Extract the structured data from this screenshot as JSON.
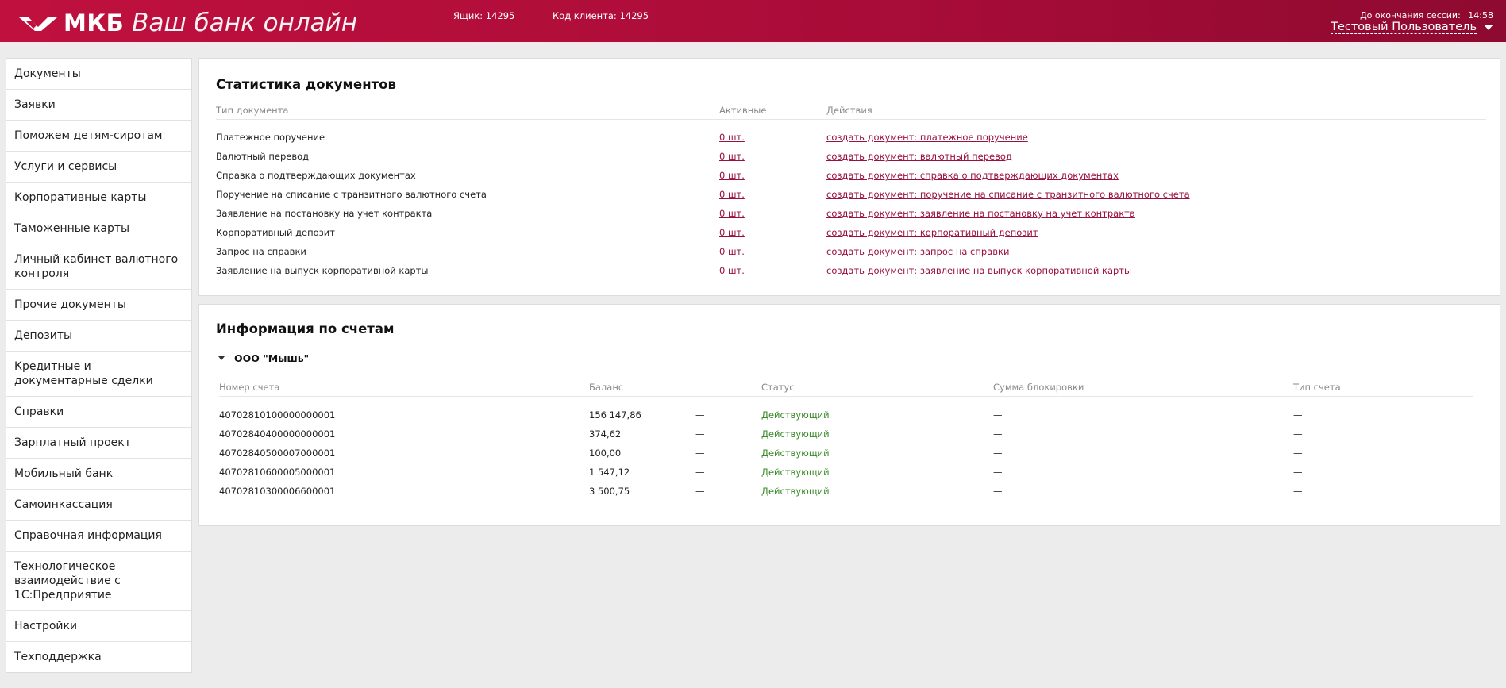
{
  "header": {
    "logo_text": "МКБ",
    "tagline": "Ваш банк онлайн",
    "mailbox": "Ящик: 14295",
    "client_code": "Код клиента: 14295",
    "session_label": "До окончания сессии:",
    "session_time": "14:58",
    "user_name": "Тестовый Пользователь"
  },
  "sidebar": {
    "items": [
      "Документы",
      "Заявки",
      "Поможем детям-сиротам",
      "Услуги и сервисы",
      "Корпоративные карты",
      "Таможенные карты",
      "Личный кабинет валютного контроля",
      "Прочие документы",
      "Депозиты",
      "Кредитные и документарные сделки",
      "Справки",
      "Зарплатный проект",
      "Мобильный банк",
      "Самоинкассация",
      "Справочная информация",
      "Технологическое взаимодействие с 1С:Предприятие",
      "Настройки",
      "Техподдержка"
    ]
  },
  "stats": {
    "title": "Статистика документов",
    "columns": {
      "type": "Тип документа",
      "active": "Активные",
      "actions": "Действия"
    },
    "rows": [
      {
        "type": "Платежное поручение",
        "active": "0 шт.",
        "action": "создать документ: платежное поручение"
      },
      {
        "type": "Валютный перевод",
        "active": "0 шт.",
        "action": "создать документ: валютный перевод"
      },
      {
        "type": "Справка о подтверждающих документах",
        "active": "0 шт.",
        "action": "создать документ: справка о подтверждающих документах"
      },
      {
        "type": "Поручение на списание с транзитного валютного счета",
        "active": "0 шт.",
        "action": "создать документ: поручение на списание с транзитного валютного счета"
      },
      {
        "type": "Заявление на постановку на учет контракта",
        "active": "0 шт.",
        "action": "создать документ: заявление на постановку на учет контракта"
      },
      {
        "type": "Корпоративный депозит",
        "active": "0 шт.",
        "action": "создать документ: корпоративный депозит"
      },
      {
        "type": "Запрос на справки",
        "active": "0 шт.",
        "action": "создать документ: запрос на справки"
      },
      {
        "type": "Заявление на выпуск корпоративной карты",
        "active": "0 шт.",
        "action": "создать документ: заявление на выпуск корпоративной карты"
      }
    ]
  },
  "accounts": {
    "title": "Информация по счетам",
    "org_name": "ООО \"Мышь\"",
    "columns": {
      "number": "Номер счета",
      "balance": "Баланс",
      "status": "Статус",
      "block_sum": "Сумма блокировки",
      "acc_type": "Тип счета"
    },
    "rows": [
      {
        "number": "40702810100000000001",
        "balance": "156 147,86",
        "dash": "—",
        "status": "Действующий",
        "block_sum": "—",
        "acc_type": "—"
      },
      {
        "number": "40702840400000000001",
        "balance": "374,62",
        "dash": "—",
        "status": "Действующий",
        "block_sum": "—",
        "acc_type": "—"
      },
      {
        "number": "40702840500007000001",
        "balance": "100,00",
        "dash": "—",
        "status": "Действующий",
        "block_sum": "—",
        "acc_type": "—"
      },
      {
        "number": "40702810600005000001",
        "balance": "1 547,12",
        "dash": "—",
        "status": "Действующий",
        "block_sum": "—",
        "acc_type": "—"
      },
      {
        "number": "40702810300006600001",
        "balance": "3 500,75",
        "dash": "—",
        "status": "Действующий",
        "block_sum": "—",
        "acc_type": "—"
      }
    ]
  },
  "colors": {
    "brand": "#b00e3c",
    "link": "#9a1040",
    "status_active": "#3a8a2a"
  },
  "icons": {
    "logo": "mkb-logo-icon",
    "user_menu": "chevron-down-icon",
    "org_toggle": "caret-down-icon"
  }
}
